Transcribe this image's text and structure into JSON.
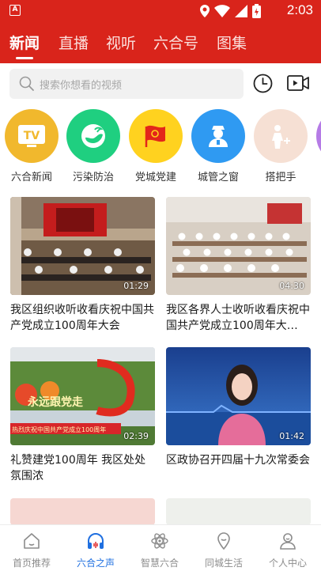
{
  "status_bar": {
    "time": "2:03",
    "app_badge": "A"
  },
  "top_nav": {
    "tabs": [
      "新闻",
      "直播",
      "视听",
      "六合号",
      "图集"
    ],
    "active": 0
  },
  "search": {
    "placeholder": "搜索你想看的视频"
  },
  "categories": [
    {
      "label": "六合新闻",
      "icon": "tv-icon",
      "color": "#f1b82d",
      "badge": "TV"
    },
    {
      "label": "污染防治",
      "icon": "eco-leaf-icon",
      "color": "#1fcf80"
    },
    {
      "label": "党城党建",
      "icon": "party-flag-icon",
      "color": "#ffd21f"
    },
    {
      "label": "城管之窗",
      "icon": "officer-icon",
      "color": "#2f9af2"
    },
    {
      "label": "搭把手",
      "icon": "helping-hand-icon",
      "color": "#f6e0d4"
    }
  ],
  "videos": [
    {
      "title": "我区组织收听收看庆祝中国共产党成立100周年大会",
      "duration": "01:29"
    },
    {
      "title": "我区各界人士收听收看庆祝中国共产党成立100周年大…",
      "duration": "04:30"
    },
    {
      "title": "礼赞建党100周年 我区处处氛围浓",
      "duration": "02:39",
      "sign_text": "永远跟党走",
      "banner_text": "热烈庆祝中国共产党成立100周年"
    },
    {
      "title": "区政协召开四届十九次常委会",
      "duration": "01:42"
    }
  ],
  "bottom_nav": [
    "首页推荐",
    "六合之声",
    "智慧六合",
    "同城生活",
    "个人中心"
  ],
  "bottom_active": 1,
  "colors": {
    "brand": "#d9241b",
    "active_blue": "#1f6fe0"
  }
}
